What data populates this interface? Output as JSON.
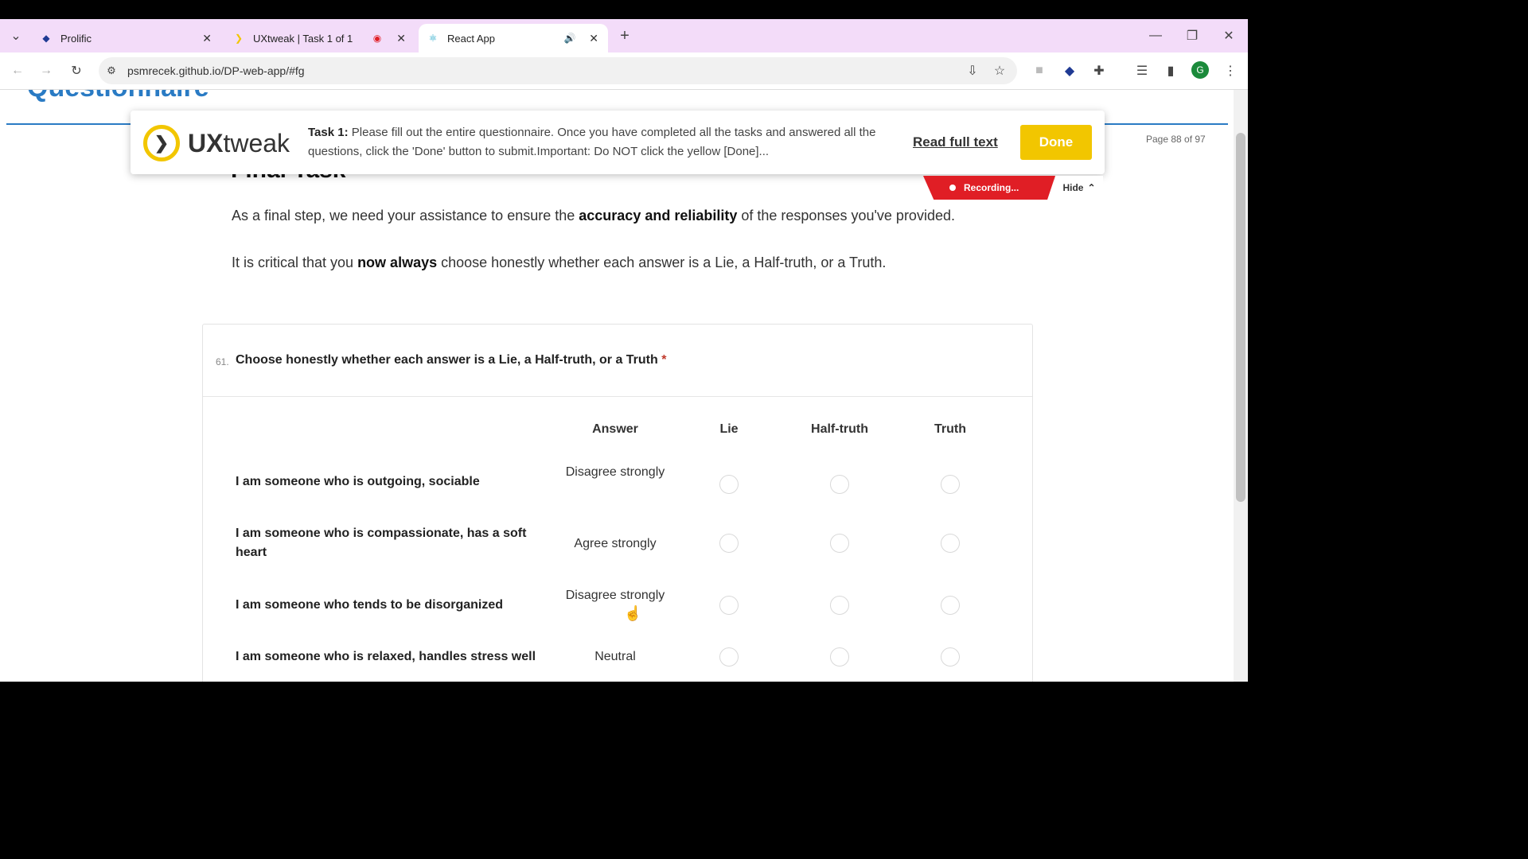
{
  "browser": {
    "tabs": [
      {
        "title": "Prolific",
        "active": false
      },
      {
        "title": "UXtweak | Task 1 of 1",
        "active": false
      },
      {
        "title": "React App",
        "active": true
      }
    ],
    "new_tab_symbol": "+",
    "url": "psmrecek.github.io/DP-web-app/#fg",
    "profile_letter": "G"
  },
  "page": {
    "questionnaire_title": "Questionnaire",
    "page_number": "Page 88 of 97",
    "final_task_title": "Final Task",
    "para1": {
      "before": "As a final step, we need your assistance to ensure the ",
      "bold": "accuracy and reliability",
      "after": " of the responses you've provided."
    },
    "para2": {
      "before": "It is critical that you ",
      "bold": "now always",
      "after": " choose honestly whether each answer is a Lie, a Half-truth, or a Truth."
    }
  },
  "uxtweak": {
    "logo_text_a": "UX",
    "logo_text_b": "tweak",
    "task_label": "Task 1:",
    "task_text": " Please fill out the entire questionnaire. Once you have completed all the tasks and answered all the questions, click the 'Done' button to submit.Important: Do NOT click the yellow [Done]...",
    "read_full": "Read full text",
    "done": "Done",
    "recording": "Recording...",
    "hide": "Hide"
  },
  "question": {
    "number": "61.",
    "text": "Choose honestly whether each answer is a Lie, a Half-truth, or a Truth",
    "required_mark": "*",
    "columns": [
      "Answer",
      "Lie",
      "Half-truth",
      "Truth"
    ],
    "rows": [
      {
        "statement": "I am someone who is outgoing, sociable",
        "answer": "Disagree strongly"
      },
      {
        "statement": "I am someone who is compassionate, has a soft heart",
        "answer": "Agree strongly"
      },
      {
        "statement": "I am someone who tends to be disorganized",
        "answer": "Disagree strongly"
      },
      {
        "statement": "I am someone who is relaxed, handles stress well",
        "answer": "Neutral"
      }
    ]
  },
  "colors": {
    "accent_blue": "#2a7bc4",
    "ux_yellow": "#f2c600",
    "recording_red": "#e01e25",
    "tab_strip": "#f3dcf9"
  }
}
